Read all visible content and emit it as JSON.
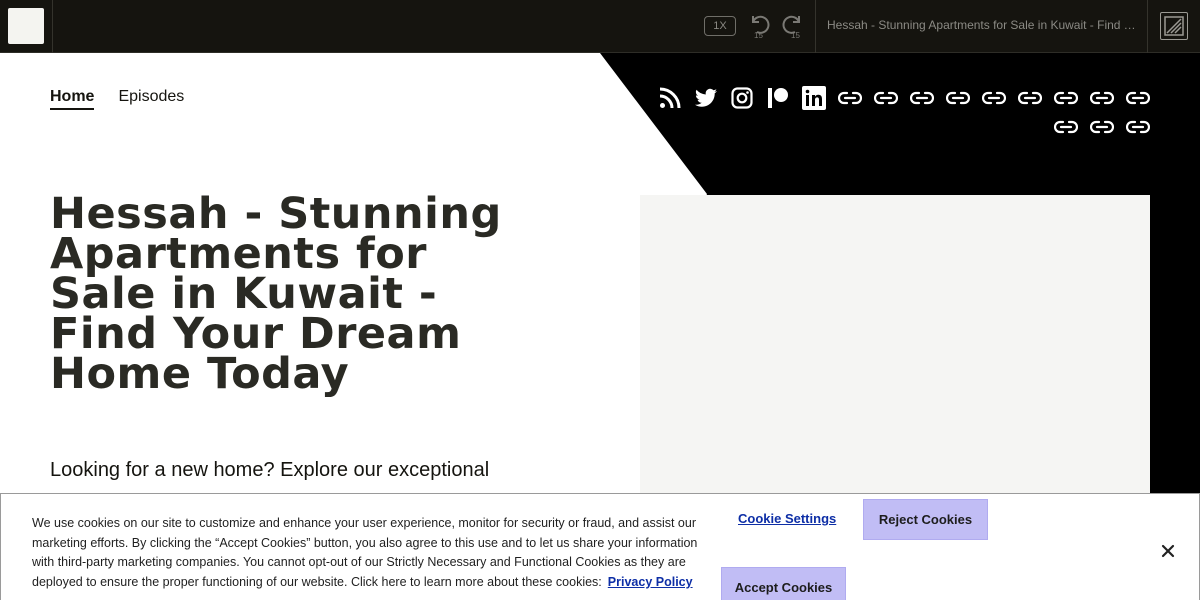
{
  "player": {
    "speed": "1X",
    "skip_back": "15",
    "skip_forward": "15",
    "title": "Hessah - Stunning Apartments for Sale in Kuwait - Find Your Dream Home Today"
  },
  "nav": {
    "items": [
      {
        "label": "Home",
        "active": true
      },
      {
        "label": "Episodes",
        "active": false
      }
    ]
  },
  "social_icons": [
    "rss-icon",
    "twitter-icon",
    "instagram-icon",
    "patreon-icon",
    "linkedin-icon",
    "link-icon",
    "link-icon",
    "link-icon",
    "link-icon",
    "link-icon",
    "link-icon",
    "link-icon",
    "link-icon",
    "link-icon",
    "link-icon",
    "link-icon",
    "link-icon"
  ],
  "hero": {
    "title": "Hessah - Stunning Apartments for Sale in Kuwait - Find Your Dream Home Today",
    "description": "Looking for a new home? Explore our exceptional"
  },
  "cookie_banner": {
    "text": "We use cookies on our site to customize and enhance your user experience, monitor for security or fraud, and assist our marketing efforts. By clicking the “Accept Cookies” button, you also agree to this use and to let us share your information with third-party marketing companies. You cannot opt-out of our Strictly Necessary and Functional Cookies as they are deployed to ensure the proper functioning of our website. Click here to learn more about these cookies:",
    "privacy_link": "Privacy Policy",
    "settings_label": "Cookie Settings",
    "reject_label": "Reject Cookies",
    "accept_label": "Accept Cookies"
  },
  "colors": {
    "player_bg": "#15140f",
    "accent_button": "#c1bdf5",
    "link": "#0d2ea6"
  }
}
